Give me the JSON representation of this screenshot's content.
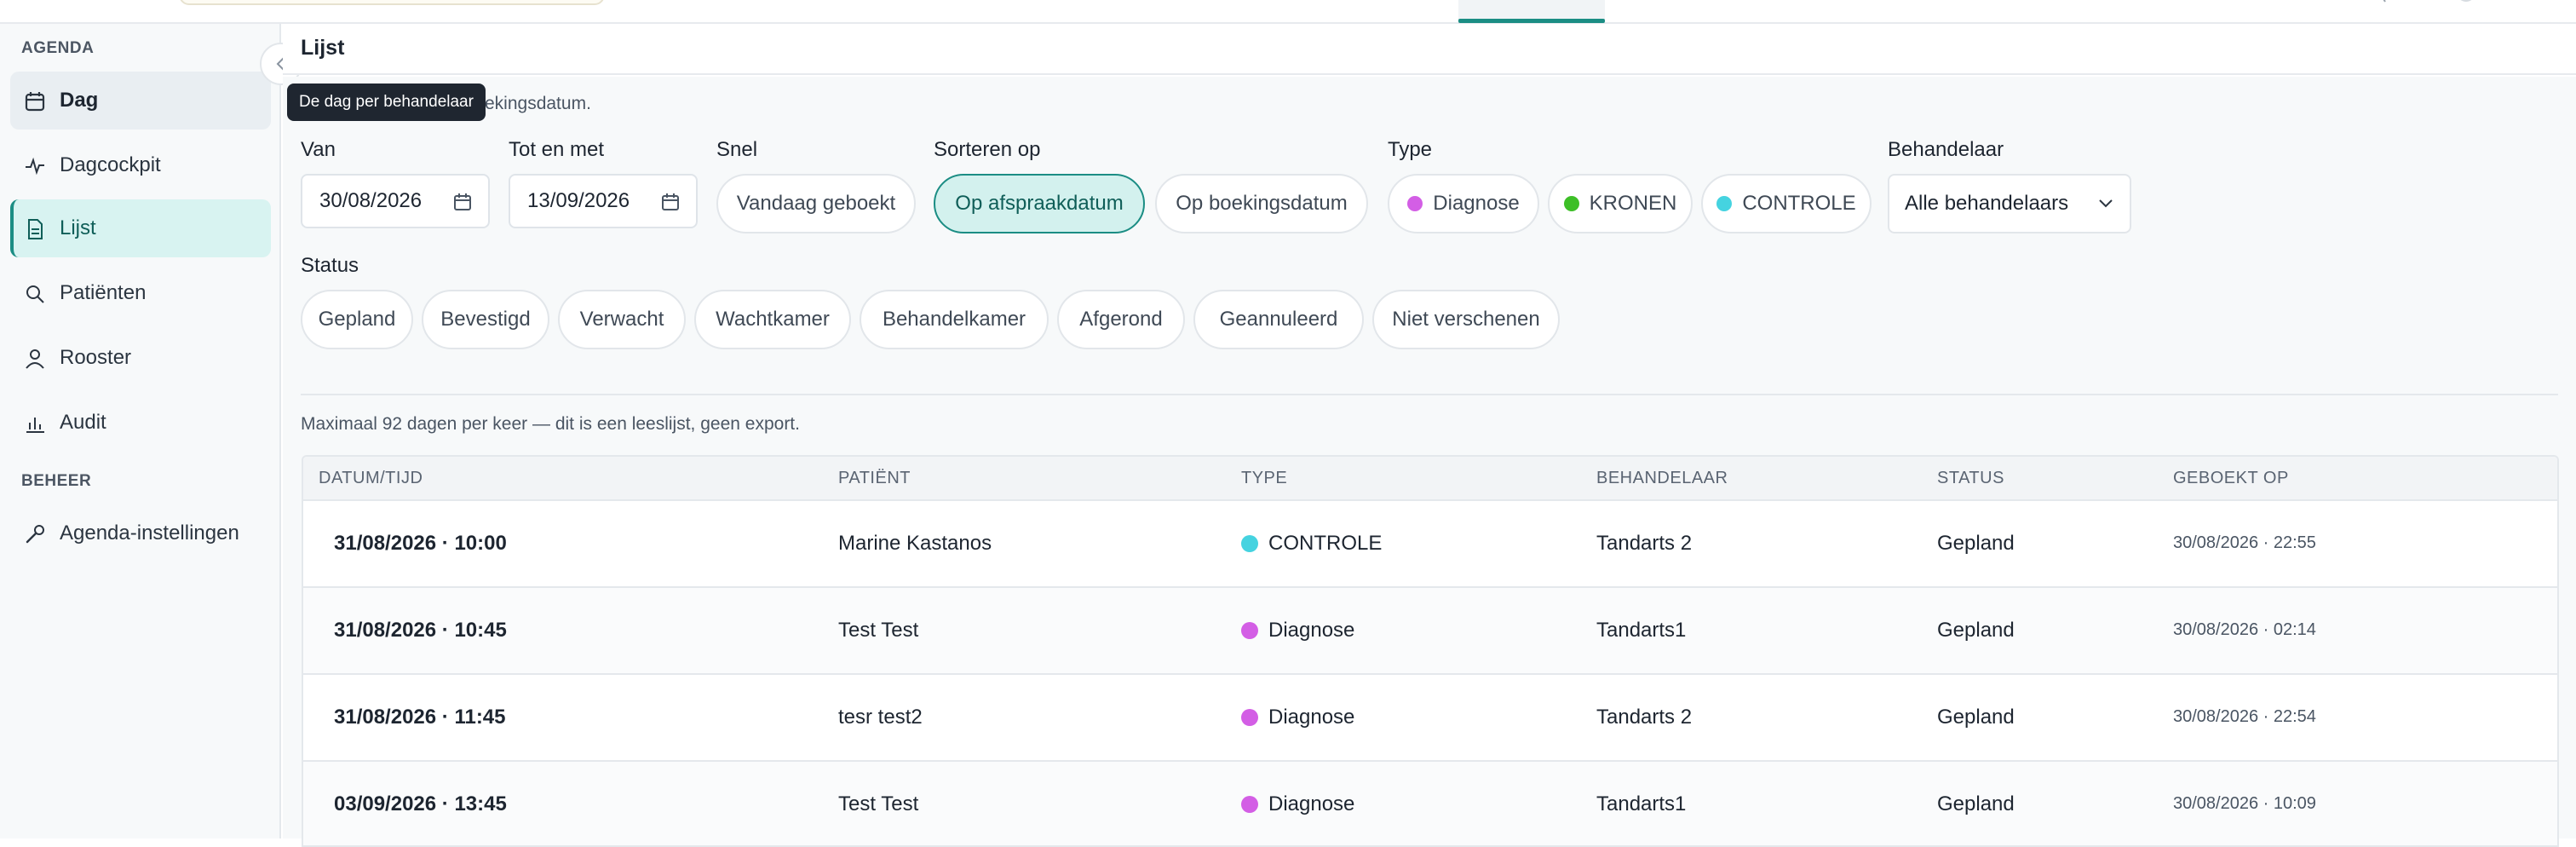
{
  "colors": {
    "accent": "#1b8d84",
    "diagnose": "#d35ee5",
    "kronen": "#3dbf27",
    "controle": "#45d3e0"
  },
  "sidebar": {
    "section_agenda": "AGENDA",
    "section_beheer": "BEHEER",
    "items": [
      {
        "label": "Dag",
        "icon": "calendar-icon"
      },
      {
        "label": "Dagcockpit",
        "icon": "pulse-icon"
      },
      {
        "label": "Lijst",
        "icon": "document-list-icon"
      },
      {
        "label": "Patiënten",
        "icon": "search-icon"
      },
      {
        "label": "Rooster",
        "icon": "user-icon"
      },
      {
        "label": "Audit",
        "icon": "bar-chart-icon"
      }
    ],
    "beheer_items": [
      {
        "label": "Agenda-instellingen",
        "icon": "wrench-icon"
      }
    ],
    "tooltip": "De dag per behandelaar"
  },
  "page": {
    "title": "Lijst",
    "intro": "ode, op datum of op boekingsdatum.",
    "note": "Maximaal 92 dagen per keer — dit is een leeslijst, geen export."
  },
  "filters": {
    "van_label": "Van",
    "van_value": "30/08/2026",
    "tot_label": "Tot en met",
    "tot_value": "13/09/2026",
    "snel_label": "Snel",
    "snel_button": "Vandaag geboekt",
    "sort_label": "Sorteren op",
    "sort_options": [
      "Op afspraakdatum",
      "Op boekingsdatum"
    ],
    "sort_selected": "Op afspraakdatum",
    "type_label": "Type",
    "types": [
      "Diagnose",
      "KRONEN",
      "CONTROLE"
    ],
    "behandelaar_label": "Behandelaar",
    "behandelaar_value": "Alle behandelaars",
    "status_label": "Status",
    "statuses": [
      "Gepland",
      "Bevestigd",
      "Verwacht",
      "Wachtkamer",
      "Behandelkamer",
      "Afgerond",
      "Geannuleerd",
      "Niet verschenen"
    ]
  },
  "table": {
    "columns": [
      "DATUM/TIJD",
      "PATIËNT",
      "TYPE",
      "BEHANDELAAR",
      "STATUS",
      "GEBOEKT OP"
    ],
    "rows": [
      {
        "datetime": "31/08/2026 · 10:00",
        "patient": "Marine Kastanos",
        "type": "CONTROLE",
        "behandelaar": "Tandarts 2",
        "status": "Gepland",
        "geboekt": "30/08/2026 · 22:55"
      },
      {
        "datetime": "31/08/2026 · 10:45",
        "patient": "Test Test",
        "type": "Diagnose",
        "behandelaar": "Tandarts1",
        "status": "Gepland",
        "geboekt": "30/08/2026 · 02:14"
      },
      {
        "datetime": "31/08/2026 · 11:45",
        "patient": "tesr test2",
        "type": "Diagnose",
        "behandelaar": "Tandarts 2",
        "status": "Gepland",
        "geboekt": "30/08/2026 · 22:54"
      },
      {
        "datetime": "03/09/2026 · 13:45",
        "patient": "Test Test",
        "type": "Diagnose",
        "behandelaar": "Tandarts1",
        "status": "Gepland",
        "geboekt": "30/08/2026 · 10:09"
      }
    ]
  }
}
